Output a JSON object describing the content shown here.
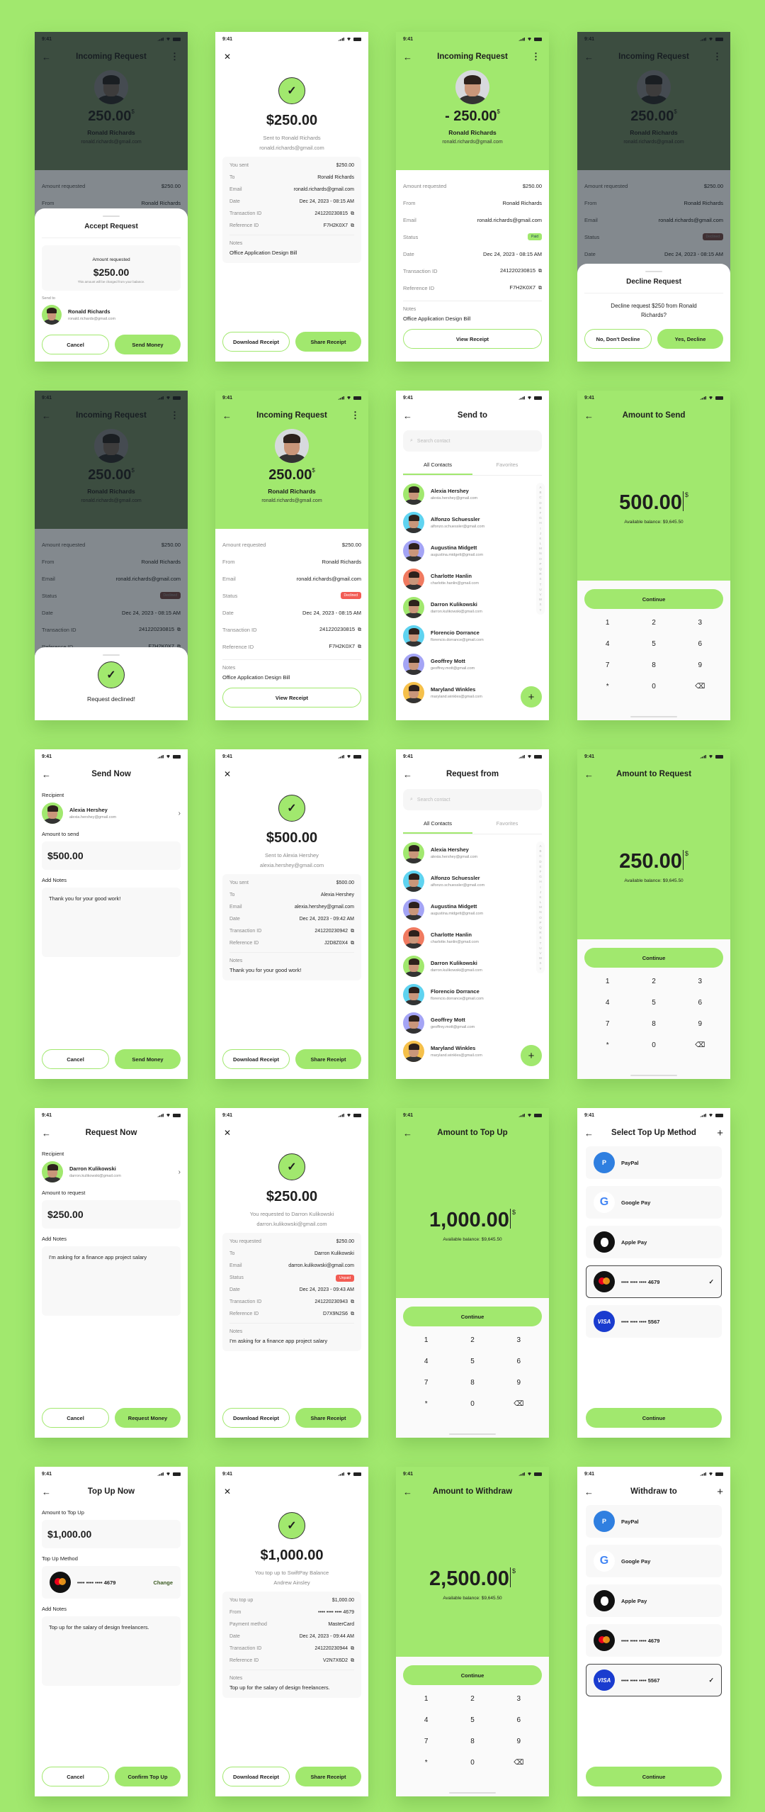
{
  "status_time": "9:41",
  "accent_color": "#a1e86e",
  "danger_color": "#f25c54",
  "common": {
    "back_icon": "←",
    "close_icon": "✕",
    "more_icon": "⋮",
    "copy_icon": "⧉",
    "check_icon": "✓",
    "plus_icon": "+",
    "chevron_icon": "›",
    "search_icon": "⌕",
    "backspace_icon": "⌫",
    "keys": [
      "1",
      "2",
      "3",
      "4",
      "5",
      "6",
      "7",
      "8",
      "9",
      "*",
      "0"
    ],
    "available_balance": "Available balance: $9,645.50",
    "continue_label": "Continue",
    "cancel_label": "Cancel",
    "download_receipt": "Download Receipt",
    "share_receipt": "Share Receipt",
    "view_receipt": "View Receipt",
    "notes_label": "Notes",
    "search_placeholder": "Search contact",
    "tab_all": "All Contacts",
    "tab_fav": "Favorites",
    "alphabet": [
      "A",
      "B",
      "C",
      "D",
      "E",
      "F",
      "G",
      "H",
      "I",
      "J",
      "K",
      "L",
      "M",
      "N",
      "O",
      "P",
      "Q",
      "R",
      "S",
      "T",
      "U",
      "V",
      "W",
      "X",
      "Y"
    ]
  },
  "incoming": {
    "title": "Incoming Request",
    "amount": "250.00",
    "amount_neg": "- 250.00",
    "currency": "$",
    "name": "Ronald Richards",
    "email": "ronald.richards@gmail.com",
    "rows": [
      {
        "k": "Amount requested",
        "v": "$250.00"
      },
      {
        "k": "From",
        "v": "Ronald Richards"
      },
      {
        "k": "Email",
        "v": "ronald.richards@gmail.com"
      },
      {
        "k": "Status",
        "v": ""
      },
      {
        "k": "Date",
        "v": "Dec 24, 2023 - 08:15 AM"
      },
      {
        "k": "Transaction ID",
        "v": "241220230815"
      },
      {
        "k": "Reference ID",
        "v": "F7H2K0X7"
      }
    ],
    "status_paid": "Paid",
    "status_declined": "Declined",
    "notes": "Office Application Design Bill"
  },
  "accept_sheet": {
    "title": "Accept Request",
    "amount_label": "Amount requested",
    "amount": "$250.00",
    "hint": "This amount will be charged from your balance.",
    "send_to": "Send to",
    "send_btn": "Send Money"
  },
  "decline_sheet": {
    "title": "Decline Request",
    "message": "Decline request $250 from Ronald Richards?",
    "no_btn": "No, Don't Decline",
    "yes_btn": "Yes, Decline"
  },
  "declined_toast": {
    "message": "Request declined!"
  },
  "receipt_sent_ronald": {
    "amount": "$250.00",
    "line1": "Sent to Ronald Richards",
    "line2": "ronald.richards@gmail.com",
    "rows": [
      {
        "k": "You sent",
        "v": "$250.00"
      },
      {
        "k": "To",
        "v": "Ronald Richards"
      },
      {
        "k": "Email",
        "v": "ronald.richards@gmail.com"
      },
      {
        "k": "Date",
        "v": "Dec 24, 2023 - 08:15 AM"
      },
      {
        "k": "Transaction ID",
        "v": "241220230815"
      },
      {
        "k": "Reference ID",
        "v": "F7H2K0X7"
      }
    ],
    "notes": "Office Application Design Bill"
  },
  "send_to": {
    "title": "Send to"
  },
  "request_from": {
    "title": "Request from"
  },
  "contacts": [
    {
      "name": "Alexia Hershey",
      "email": "alexia.hershey@gmail.com",
      "bg": "#a1e86e"
    },
    {
      "name": "Alfonzo Schuessler",
      "email": "alfonzo.schuessler@gmail.com",
      "bg": "#5fd3f0"
    },
    {
      "name": "Augustina Midgett",
      "email": "augustina.midgett@gmail.com",
      "bg": "#a4a4f5"
    },
    {
      "name": "Charlotte Hanlin",
      "email": "charlotte.hanlin@gmail.com",
      "bg": "#f07a60"
    },
    {
      "name": "Darron Kulikowski",
      "email": "darron.kulikowski@gmail.com",
      "bg": "#a1e86e"
    },
    {
      "name": "Florencio Dorrance",
      "email": "florencio.dorrance@gmail.com",
      "bg": "#5fd3f0"
    },
    {
      "name": "Geoffrey Mott",
      "email": "geoffrey.mott@gmail.com",
      "bg": "#a4a4f5"
    },
    {
      "name": "Maryland Winkles",
      "email": "maryland.winkles@gmail.com",
      "bg": "#f5c04a"
    }
  ],
  "amount_send": {
    "title": "Amount to Send",
    "value": "500.00"
  },
  "amount_request": {
    "title": "Amount to Request",
    "value": "250.00"
  },
  "amount_topup": {
    "title": "Amount to Top Up",
    "value": "1,000.00"
  },
  "amount_withdraw": {
    "title": "Amount to Withdraw",
    "value": "2,500.00"
  },
  "send_now": {
    "title": "Send Now",
    "recipient_label": "Recipient",
    "name": "Alexia Hershey",
    "email": "alexia.hershey@gmail.com",
    "amount_label": "Amount to send",
    "amount": "$500.00",
    "notes_label": "Add Notes",
    "notes": "Thank you for your good work!",
    "submit": "Send Money"
  },
  "receipt_sent_alexia": {
    "amount": "$500.00",
    "line1": "Sent to Alexia Hershey",
    "line2": "alexia.hershey@gmail.com",
    "rows": [
      {
        "k": "You sent",
        "v": "$500.00"
      },
      {
        "k": "To",
        "v": "Alexia Hershey"
      },
      {
        "k": "Email",
        "v": "alexia.hershey@gmail.com"
      },
      {
        "k": "Date",
        "v": "Dec 24, 2023 - 09:42 AM"
      },
      {
        "k": "Transaction ID",
        "v": "241220230942"
      },
      {
        "k": "Reference ID",
        "v": "J2D8Z0X4"
      }
    ],
    "notes": "Thank you for your good work!"
  },
  "request_now": {
    "title": "Request Now",
    "recipient_label": "Recipient",
    "name": "Darron Kulikowski",
    "email": "darron.kulikowski@gmail.com",
    "amount_label": "Amount to request",
    "amount": "$250.00",
    "notes_label": "Add Notes",
    "notes": "I'm asking for a finance app project salary",
    "submit": "Request Money"
  },
  "receipt_request": {
    "amount": "$250.00",
    "line1": "You requested to Darron Kulikowski",
    "line2": "darron.kulikowski@gmail.com",
    "rows": [
      {
        "k": "You requested",
        "v": "$250.00"
      },
      {
        "k": "To",
        "v": "Darron Kulikowski"
      },
      {
        "k": "Email",
        "v": "darron.kulikowski@gmail.com"
      },
      {
        "k": "Status",
        "v": "Unpaid"
      },
      {
        "k": "Date",
        "v": "Dec 24, 2023 - 09:43 AM"
      },
      {
        "k": "Transaction ID",
        "v": "241220230943"
      },
      {
        "k": "Reference ID",
        "v": "D7X9N2S6"
      }
    ],
    "notes": "I'm asking for a finance app project salary"
  },
  "methods": [
    {
      "label": "PayPal",
      "icon": "P",
      "bg": "#2f7fe0"
    },
    {
      "label": "Google Pay",
      "icon": "G",
      "bg": "#ffffff"
    },
    {
      "label": "Apple Pay",
      "icon": "",
      "bg": "#111111"
    },
    {
      "label": "•••• •••• •••• 4679",
      "icon": "",
      "bg": "#111111"
    },
    {
      "label": "•••• •••• •••• 5567",
      "icon": "VISA",
      "bg": "#1a3ccf"
    }
  ],
  "select_topup": {
    "title": "Select Top Up Method",
    "selected": 3
  },
  "withdraw_to": {
    "title": "Withdraw to",
    "selected": 4
  },
  "topup_now": {
    "title": "Top Up Now",
    "amount_label": "Amount to Top Up",
    "amount": "$1,000.00",
    "method_label": "Top Up Method",
    "card": "•••• •••• •••• 4679",
    "change": "Change",
    "notes_label": "Add Notes",
    "notes": "Top up for the salary of design freelancers.",
    "submit": "Confirm Top Up"
  },
  "receipt_topup": {
    "amount": "$1,000.00",
    "line1": "You top up to SwiftPay Balance",
    "line2": "Andrew Ainsley",
    "rows": [
      {
        "k": "You top up",
        "v": "$1,000.00"
      },
      {
        "k": "From",
        "v": "•••• •••• •••• 4679"
      },
      {
        "k": "Payment method",
        "v": "MasterCard"
      },
      {
        "k": "Date",
        "v": "Dec 24, 2023 - 09:44 AM"
      },
      {
        "k": "Transaction ID",
        "v": "241220230944"
      },
      {
        "k": "Reference ID",
        "v": "V2N7X6D2"
      }
    ],
    "notes": "Top up for the salary of design freelancers."
  }
}
